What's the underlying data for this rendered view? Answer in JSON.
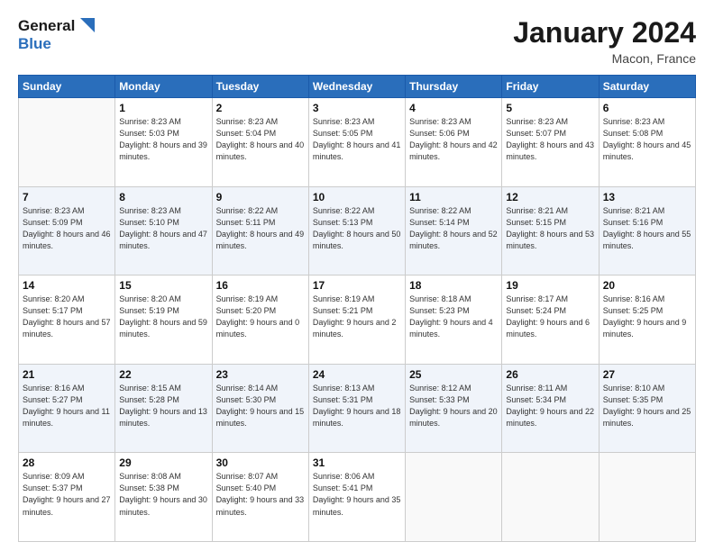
{
  "header": {
    "logo_line1": "General",
    "logo_line2": "Blue",
    "month": "January 2024",
    "location": "Macon, France"
  },
  "weekdays": [
    "Sunday",
    "Monday",
    "Tuesday",
    "Wednesday",
    "Thursday",
    "Friday",
    "Saturday"
  ],
  "weeks": [
    [
      {
        "day": "",
        "sunrise": "",
        "sunset": "",
        "daylight": ""
      },
      {
        "day": "1",
        "sunrise": "Sunrise: 8:23 AM",
        "sunset": "Sunset: 5:03 PM",
        "daylight": "Daylight: 8 hours and 39 minutes."
      },
      {
        "day": "2",
        "sunrise": "Sunrise: 8:23 AM",
        "sunset": "Sunset: 5:04 PM",
        "daylight": "Daylight: 8 hours and 40 minutes."
      },
      {
        "day": "3",
        "sunrise": "Sunrise: 8:23 AM",
        "sunset": "Sunset: 5:05 PM",
        "daylight": "Daylight: 8 hours and 41 minutes."
      },
      {
        "day": "4",
        "sunrise": "Sunrise: 8:23 AM",
        "sunset": "Sunset: 5:06 PM",
        "daylight": "Daylight: 8 hours and 42 minutes."
      },
      {
        "day": "5",
        "sunrise": "Sunrise: 8:23 AM",
        "sunset": "Sunset: 5:07 PM",
        "daylight": "Daylight: 8 hours and 43 minutes."
      },
      {
        "day": "6",
        "sunrise": "Sunrise: 8:23 AM",
        "sunset": "Sunset: 5:08 PM",
        "daylight": "Daylight: 8 hours and 45 minutes."
      }
    ],
    [
      {
        "day": "7",
        "sunrise": "Sunrise: 8:23 AM",
        "sunset": "Sunset: 5:09 PM",
        "daylight": "Daylight: 8 hours and 46 minutes."
      },
      {
        "day": "8",
        "sunrise": "Sunrise: 8:23 AM",
        "sunset": "Sunset: 5:10 PM",
        "daylight": "Daylight: 8 hours and 47 minutes."
      },
      {
        "day": "9",
        "sunrise": "Sunrise: 8:22 AM",
        "sunset": "Sunset: 5:11 PM",
        "daylight": "Daylight: 8 hours and 49 minutes."
      },
      {
        "day": "10",
        "sunrise": "Sunrise: 8:22 AM",
        "sunset": "Sunset: 5:13 PM",
        "daylight": "Daylight: 8 hours and 50 minutes."
      },
      {
        "day": "11",
        "sunrise": "Sunrise: 8:22 AM",
        "sunset": "Sunset: 5:14 PM",
        "daylight": "Daylight: 8 hours and 52 minutes."
      },
      {
        "day": "12",
        "sunrise": "Sunrise: 8:21 AM",
        "sunset": "Sunset: 5:15 PM",
        "daylight": "Daylight: 8 hours and 53 minutes."
      },
      {
        "day": "13",
        "sunrise": "Sunrise: 8:21 AM",
        "sunset": "Sunset: 5:16 PM",
        "daylight": "Daylight: 8 hours and 55 minutes."
      }
    ],
    [
      {
        "day": "14",
        "sunrise": "Sunrise: 8:20 AM",
        "sunset": "Sunset: 5:17 PM",
        "daylight": "Daylight: 8 hours and 57 minutes."
      },
      {
        "day": "15",
        "sunrise": "Sunrise: 8:20 AM",
        "sunset": "Sunset: 5:19 PM",
        "daylight": "Daylight: 8 hours and 59 minutes."
      },
      {
        "day": "16",
        "sunrise": "Sunrise: 8:19 AM",
        "sunset": "Sunset: 5:20 PM",
        "daylight": "Daylight: 9 hours and 0 minutes."
      },
      {
        "day": "17",
        "sunrise": "Sunrise: 8:19 AM",
        "sunset": "Sunset: 5:21 PM",
        "daylight": "Daylight: 9 hours and 2 minutes."
      },
      {
        "day": "18",
        "sunrise": "Sunrise: 8:18 AM",
        "sunset": "Sunset: 5:23 PM",
        "daylight": "Daylight: 9 hours and 4 minutes."
      },
      {
        "day": "19",
        "sunrise": "Sunrise: 8:17 AM",
        "sunset": "Sunset: 5:24 PM",
        "daylight": "Daylight: 9 hours and 6 minutes."
      },
      {
        "day": "20",
        "sunrise": "Sunrise: 8:16 AM",
        "sunset": "Sunset: 5:25 PM",
        "daylight": "Daylight: 9 hours and 9 minutes."
      }
    ],
    [
      {
        "day": "21",
        "sunrise": "Sunrise: 8:16 AM",
        "sunset": "Sunset: 5:27 PM",
        "daylight": "Daylight: 9 hours and 11 minutes."
      },
      {
        "day": "22",
        "sunrise": "Sunrise: 8:15 AM",
        "sunset": "Sunset: 5:28 PM",
        "daylight": "Daylight: 9 hours and 13 minutes."
      },
      {
        "day": "23",
        "sunrise": "Sunrise: 8:14 AM",
        "sunset": "Sunset: 5:30 PM",
        "daylight": "Daylight: 9 hours and 15 minutes."
      },
      {
        "day": "24",
        "sunrise": "Sunrise: 8:13 AM",
        "sunset": "Sunset: 5:31 PM",
        "daylight": "Daylight: 9 hours and 18 minutes."
      },
      {
        "day": "25",
        "sunrise": "Sunrise: 8:12 AM",
        "sunset": "Sunset: 5:33 PM",
        "daylight": "Daylight: 9 hours and 20 minutes."
      },
      {
        "day": "26",
        "sunrise": "Sunrise: 8:11 AM",
        "sunset": "Sunset: 5:34 PM",
        "daylight": "Daylight: 9 hours and 22 minutes."
      },
      {
        "day": "27",
        "sunrise": "Sunrise: 8:10 AM",
        "sunset": "Sunset: 5:35 PM",
        "daylight": "Daylight: 9 hours and 25 minutes."
      }
    ],
    [
      {
        "day": "28",
        "sunrise": "Sunrise: 8:09 AM",
        "sunset": "Sunset: 5:37 PM",
        "daylight": "Daylight: 9 hours and 27 minutes."
      },
      {
        "day": "29",
        "sunrise": "Sunrise: 8:08 AM",
        "sunset": "Sunset: 5:38 PM",
        "daylight": "Daylight: 9 hours and 30 minutes."
      },
      {
        "day": "30",
        "sunrise": "Sunrise: 8:07 AM",
        "sunset": "Sunset: 5:40 PM",
        "daylight": "Daylight: 9 hours and 33 minutes."
      },
      {
        "day": "31",
        "sunrise": "Sunrise: 8:06 AM",
        "sunset": "Sunset: 5:41 PM",
        "daylight": "Daylight: 9 hours and 35 minutes."
      },
      {
        "day": "",
        "sunrise": "",
        "sunset": "",
        "daylight": ""
      },
      {
        "day": "",
        "sunrise": "",
        "sunset": "",
        "daylight": ""
      },
      {
        "day": "",
        "sunrise": "",
        "sunset": "",
        "daylight": ""
      }
    ]
  ]
}
